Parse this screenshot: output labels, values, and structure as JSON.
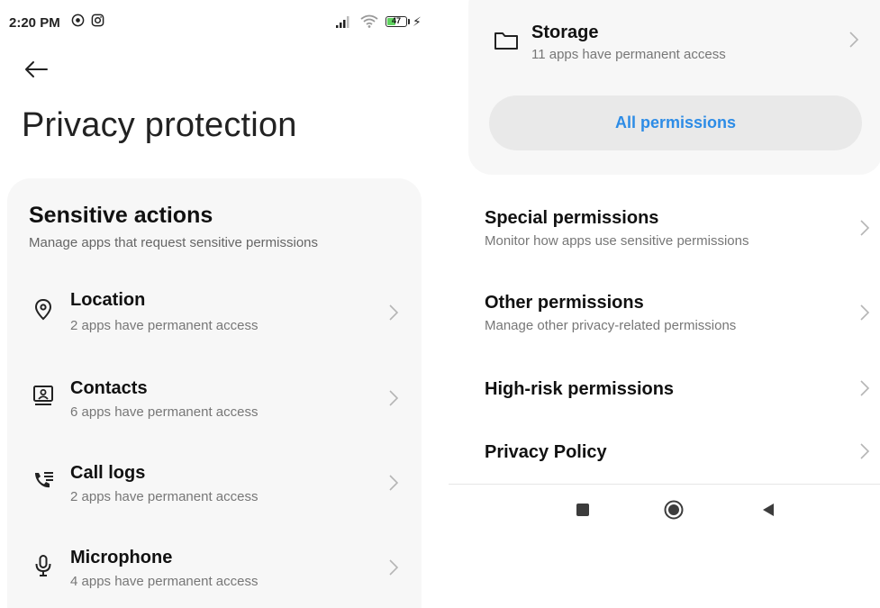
{
  "status_bar": {
    "time": "2:20 PM",
    "battery_level": "47",
    "battery_fraction": 0.47,
    "icons": [
      "screen-record-icon",
      "instagram-icon",
      "signal-icon",
      "wifi-icon",
      "battery-icon",
      "charging-bolt-icon"
    ]
  },
  "header": {
    "back_icon": "arrow-left-icon",
    "title": "Privacy protection"
  },
  "sensitive_actions": {
    "title": "Sensitive actions",
    "subtitle": "Manage apps that request sensitive permissions",
    "items": [
      {
        "icon": "location-pin-icon",
        "label": "Location",
        "sub": "2 apps have permanent access"
      },
      {
        "icon": "contacts-icon",
        "label": "Contacts",
        "sub": "6 apps have permanent access"
      },
      {
        "icon": "call-log-icon",
        "label": "Call logs",
        "sub": "2 apps have permanent access"
      },
      {
        "icon": "microphone-icon",
        "label": "Microphone",
        "sub": "4 apps have permanent access"
      }
    ]
  },
  "storage": {
    "icon": "folder-icon",
    "label": "Storage",
    "sub": "11 apps have permanent access"
  },
  "all_permissions_label": "All permissions",
  "menu": [
    {
      "label": "Special permissions",
      "sub": "Monitor how apps use sensitive permissions"
    },
    {
      "label": "Other permissions",
      "sub": "Manage other privacy-related permissions"
    },
    {
      "label": "High-risk permissions",
      "sub": ""
    },
    {
      "label": "Privacy Policy",
      "sub": ""
    }
  ],
  "nav_bar": {
    "icons": [
      "recents-square-icon",
      "home-circle-icon",
      "back-triangle-icon"
    ]
  },
  "colors": {
    "accent": "#2d8ce6",
    "card_bg": "#f7f7f7",
    "button_bg": "#e9e9e9",
    "battery_fill": "#5fd35f"
  }
}
